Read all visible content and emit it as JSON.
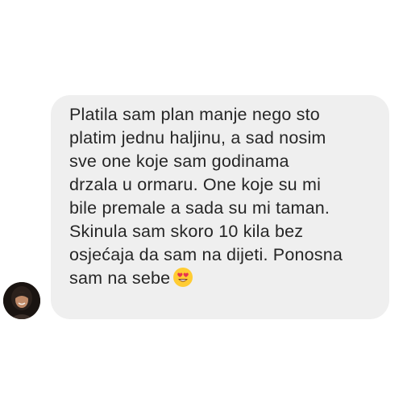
{
  "message": {
    "text": "Platila sam plan manje nego sto\nplatim jednu haljinu, a sad nosim\nsve one koje sam godinama\ndrzala u ormaru. One koje su mi\nbile premale a sada su mi taman.\nSkinula sam skoro 10 kila bez\nosjećaja da sam na dijeti. Ponosna\nsam na sebe",
    "emoji": "heart-eyes-emoji"
  },
  "sender": {
    "avatar": "profile-photo"
  },
  "colors": {
    "bubble_background": "#efefef",
    "text": "#262626",
    "page_background": "#ffffff"
  }
}
